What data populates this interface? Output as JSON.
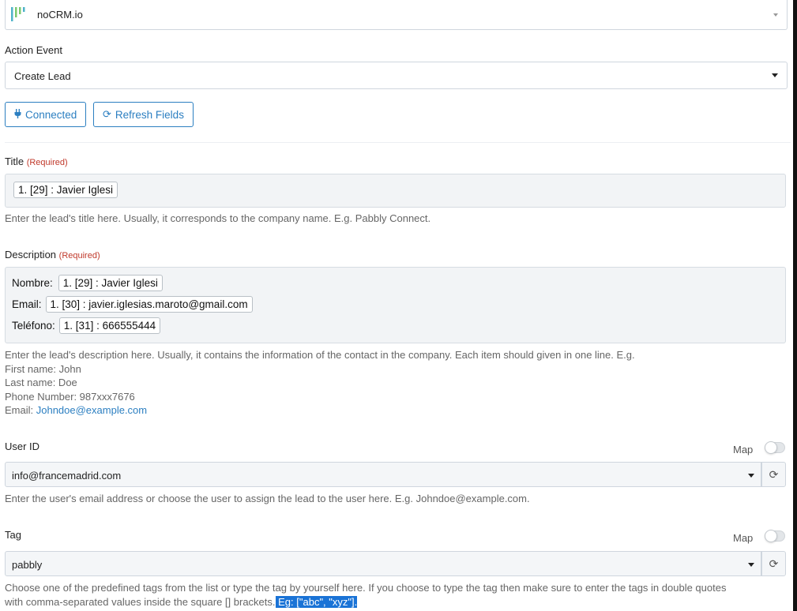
{
  "app": {
    "selected_app": "noCRM.io",
    "logo_icon": "nocrm-logo-icon"
  },
  "action_event": {
    "label": "Action Event",
    "value": "Create Lead"
  },
  "buttons": {
    "connected": "Connected",
    "connected_icon": "plug-icon",
    "refresh": "Refresh Fields",
    "refresh_icon": "refresh-icon"
  },
  "title_field": {
    "label": "Title",
    "required": "(Required)",
    "chip": "1. [29] : Javier Iglesi",
    "help": "Enter the lead's title here. Usually, it corresponds to the company name. E.g. Pabbly Connect."
  },
  "description_field": {
    "label": "Description",
    "required": "(Required)",
    "lines": [
      {
        "prefix": "Nombre:",
        "chip": "1. [29] : Javier Iglesi"
      },
      {
        "prefix": "Email:",
        "chip": "1. [30] : javier.iglesias.maroto@gmail.com"
      },
      {
        "prefix": "Teléfono:",
        "chip": "1. [31] : 666555444"
      }
    ],
    "help_intro": "Enter the lead's description here. Usually, it contains the information of the contact in the company. Each item should given in one line. E.g.",
    "help_first": "First name: John",
    "help_last": "Last name: Doe",
    "help_phone": "Phone Number: 987xxx7676",
    "help_email_prefix": "Email: ",
    "help_email_link": "Johndoe@example.com"
  },
  "user_id_field": {
    "label": "User ID",
    "map_label": "Map",
    "map_on": false,
    "value": "info@francemadrid.com",
    "help": "Enter the user's email address or choose the user to assign the lead to the user here. E.g. Johndoe@example.com."
  },
  "tag_field": {
    "label": "Tag",
    "map_label": "Map",
    "map_on": false,
    "value": "pabbly",
    "help_line1": "Choose one of the predefined tags from the list or type the tag by yourself here. If you choose to type the tag then make sure to enter the tags in double quotes",
    "help_line2": "with comma-separated values inside the square [] brackets.",
    "help_highlight": " Eg: [\"abc\", \"xyz\"]."
  },
  "colors": {
    "accent": "#2c7fc1",
    "required": "#c0392b",
    "highlight": "#1a73d6"
  }
}
